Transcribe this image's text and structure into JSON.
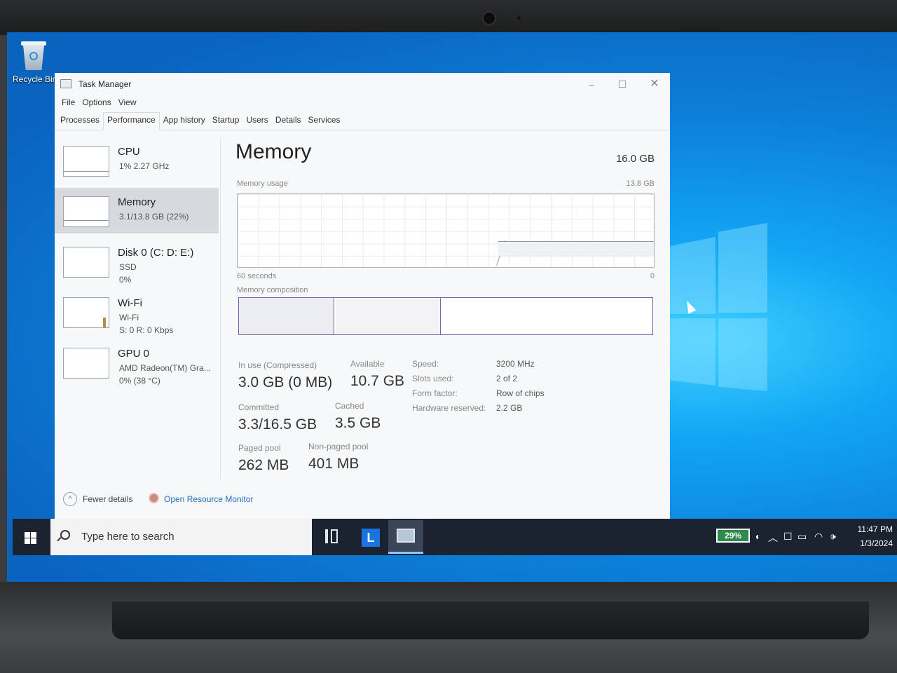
{
  "desktop": {
    "recycle_bin_label": "Recycle Bin"
  },
  "task_manager": {
    "title": "Task Manager",
    "window_controls": {
      "minimize": "–",
      "maximize": "☐",
      "close": "✕"
    },
    "menu": [
      "File",
      "Options",
      "View"
    ],
    "tabs": [
      "Processes",
      "Performance",
      "App history",
      "Startup",
      "Users",
      "Details",
      "Services"
    ],
    "active_tab": "Performance",
    "resources": [
      {
        "name": "CPU",
        "sub": "1% 2.27 GHz",
        "sub2": ""
      },
      {
        "name": "Memory",
        "sub": "3.1/13.8 GB (22%)",
        "sub2": ""
      },
      {
        "name": "Disk 0 (C: D: E:)",
        "sub": "SSD",
        "sub2": "0%"
      },
      {
        "name": "Wi-Fi",
        "sub": "Wi-Fi",
        "sub2": "S: 0 R: 0 Kbps"
      },
      {
        "name": "GPU 0",
        "sub": "AMD Radeon(TM) Gra...",
        "sub2": "0% (38 °C)"
      }
    ],
    "selected_resource": "Memory",
    "memory": {
      "title": "Memory",
      "total": "16.0 GB",
      "usage_label": "Memory usage",
      "usage_max": "13.8 GB",
      "time_label": "60 seconds",
      "time_end": "0",
      "composition_label": "Memory composition",
      "stats": {
        "in_use_label": "In use (Compressed)",
        "in_use_value": "3.0 GB (0 MB)",
        "available_label": "Available",
        "available_value": "10.7 GB",
        "committed_label": "Committed",
        "committed_value": "3.3/16.5 GB",
        "cached_label": "Cached",
        "cached_value": "3.5 GB",
        "paged_label": "Paged pool",
        "paged_value": "262 MB",
        "nonpaged_label": "Non-paged pool",
        "nonpaged_value": "401 MB"
      },
      "specs": {
        "speed_label": "Speed:",
        "speed_value": "3200 MHz",
        "slots_label": "Slots used:",
        "slots_value": "2 of 2",
        "form_label": "Form factor:",
        "form_value": "Row of chips",
        "reserved_label": "Hardware reserved:",
        "reserved_value": "2.2 GB"
      }
    },
    "footer": {
      "fewer_details": "Fewer details",
      "open_resource_monitor": "Open Resource Monitor"
    }
  },
  "taskbar": {
    "search_placeholder": "Type here to search",
    "app_l_glyph": "L",
    "battery": "29%",
    "clock_time": "11:47 PM",
    "clock_date": "1/3/2024",
    "tray_icons": [
      "speaker-small-icon",
      "chevron-up-icon",
      "tablet-icon",
      "battery-icon",
      "wifi-icon",
      "volume-icon"
    ]
  },
  "colors": {
    "desktop_blue": "#0c7fd8",
    "composition_border": "#7363a8",
    "link_blue": "#1f6fc4",
    "taskbar": "#1b2330",
    "battery_green": "#2e8a4c"
  }
}
